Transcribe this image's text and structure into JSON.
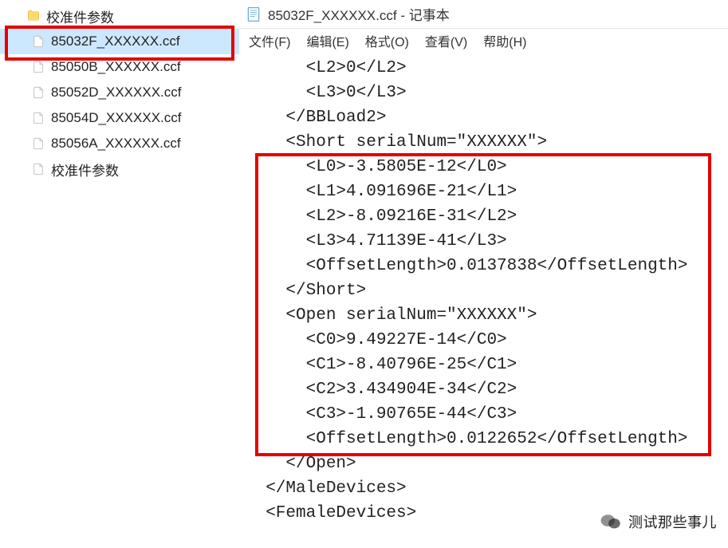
{
  "sidebar": {
    "folder": {
      "name": "校准件参数"
    },
    "files": [
      {
        "name": "85032F_XXXXXX.ccf",
        "selected": true
      },
      {
        "name": "85050B_XXXXXX.ccf",
        "selected": false
      },
      {
        "name": "85052D_XXXXXX.ccf",
        "selected": false
      },
      {
        "name": "85054D_XXXXXX.ccf",
        "selected": false
      },
      {
        "name": "85056A_XXXXXX.ccf",
        "selected": false
      },
      {
        "name": "校准件参数",
        "selected": false
      }
    ]
  },
  "notepad": {
    "title": "85032F_XXXXXX.ccf - 记事本",
    "menus": [
      {
        "label": "文件(F)"
      },
      {
        "label": "编辑(E)"
      },
      {
        "label": "格式(O)"
      },
      {
        "label": "查看(V)"
      },
      {
        "label": "帮助(H)"
      }
    ],
    "lines": [
      "      <L2>0</L2>",
      "      <L3>0</L3>",
      "    </BBLoad2>",
      "    <Short serialNum=\"XXXXXX\">",
      "      <L0>-3.5805E-12</L0>",
      "      <L1>4.091696E-21</L1>",
      "      <L2>-8.09216E-31</L2>",
      "      <L3>4.71139E-41</L3>",
      "      <OffsetLength>0.0137838</OffsetLength>",
      "    </Short>",
      "    <Open serialNum=\"XXXXXX\">",
      "      <C0>9.49227E-14</C0>",
      "      <C1>-8.40796E-25</C1>",
      "      <C2>3.434904E-34</C2>",
      "      <C3>-1.90765E-44</C3>",
      "      <OffsetLength>0.0122652</OffsetLength>",
      "    </Open>",
      "  </MaleDevices>",
      "  <FemaleDevices>"
    ]
  },
  "watermark": {
    "text": "测试那些事儿"
  },
  "hl_colors": {
    "red": "#e40000"
  }
}
